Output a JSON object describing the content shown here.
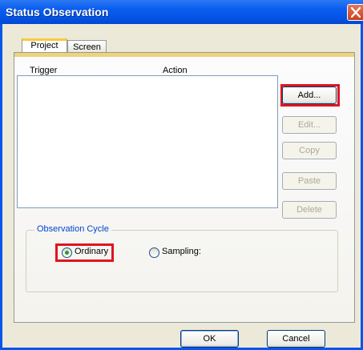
{
  "window": {
    "title": "Status Observation"
  },
  "tabs": [
    {
      "label": "Project",
      "active": true
    },
    {
      "label": "Screen",
      "active": false
    }
  ],
  "list": {
    "columns": [
      "Trigger",
      "Action"
    ],
    "rows": []
  },
  "side_buttons": [
    {
      "label": "Add...",
      "enabled": true,
      "highlighted": true
    },
    {
      "label": "Edit...",
      "enabled": false
    },
    {
      "label": "Copy",
      "enabled": false
    },
    {
      "label": "Paste",
      "enabled": false
    },
    {
      "label": "Delete",
      "enabled": false
    }
  ],
  "observation_cycle": {
    "legend": "Observation Cycle",
    "options": [
      {
        "label": "Ordinary",
        "selected": true,
        "highlighted": true
      },
      {
        "label": "Sampling:",
        "selected": false
      }
    ]
  },
  "footer": {
    "ok_label": "OK",
    "cancel_label": "Cancel"
  },
  "colors": {
    "title_bar": "#0454e6",
    "highlight_box": "#e0151e",
    "active_tab_accent": "#ffc83c",
    "group_legend": "#0046d5"
  },
  "icons": {
    "close": "close-icon",
    "radio_selected": "radio-selected-icon",
    "radio_unselected": "radio-unselected-icon"
  }
}
